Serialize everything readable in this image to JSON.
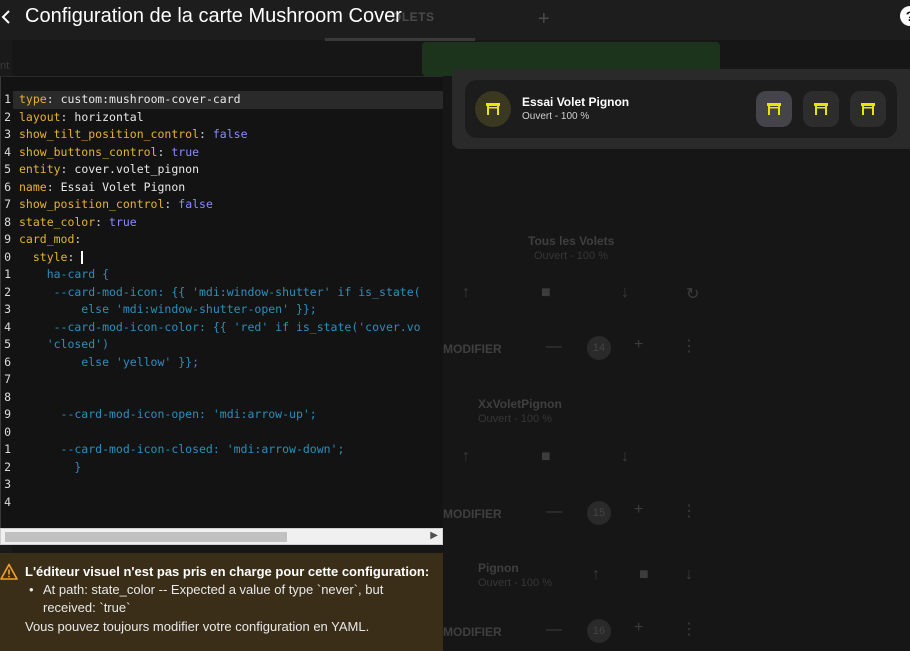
{
  "dialog": {
    "title": "Configuration de la carte Mushroom Cover",
    "back_icon": "arrow-left-icon",
    "help_icon": "help-circle-icon"
  },
  "editor": {
    "line_numbers": [
      "1",
      "2",
      "3",
      "4",
      "5",
      "6",
      "7",
      "8",
      "9",
      "0",
      "1",
      "2",
      "3",
      "4",
      "5",
      "6",
      "7",
      "8",
      "9",
      "0",
      "1",
      "2",
      "3",
      "4"
    ],
    "lines": [
      {
        "key": "type",
        "sep": ": ",
        "value": "custom:mushroom-cover-card",
        "vtype": "v"
      },
      {
        "key": "layout",
        "sep": ": ",
        "value": "horizontal",
        "vtype": "v"
      },
      {
        "key": "show_tilt_position_control",
        "sep": ": ",
        "value": "false",
        "vtype": "b"
      },
      {
        "key": "show_buttons_control",
        "sep": ": ",
        "value": "true",
        "vtype": "b"
      },
      {
        "key": "entity",
        "sep": ": ",
        "value": "cover.volet_pignon",
        "vtype": "v"
      },
      {
        "key": "name",
        "sep": ": ",
        "value": "Essai Volet Pignon",
        "vtype": "v"
      },
      {
        "key": "show_position_control",
        "sep": ": ",
        "value": "false",
        "vtype": "b"
      },
      {
        "key": "state_color",
        "sep": ": ",
        "value": "true",
        "vtype": "b"
      },
      {
        "key": "card_mod",
        "sep": ":",
        "value": "",
        "vtype": "v"
      },
      {
        "key": "  style",
        "sep": ": ",
        "value": "|",
        "vtype": "cursor"
      },
      {
        "key": "",
        "sep": "",
        "value": "    ha-card {",
        "vtype": "t"
      },
      {
        "key": "",
        "sep": "",
        "value": "     --card-mod-icon: {{ 'mdi:window-shutter' if is_state(",
        "vtype": "t"
      },
      {
        "key": "",
        "sep": "",
        "value": "         else 'mdi:window-shutter-open' }};",
        "vtype": "t"
      },
      {
        "key": "",
        "sep": "",
        "value": "     --card-mod-icon-color: {{ 'red' if is_state('cover.vo",
        "vtype": "t"
      },
      {
        "key": "",
        "sep": "",
        "value": "    'closed')",
        "vtype": "t"
      },
      {
        "key": "",
        "sep": "",
        "value": "         else 'yellow' }};",
        "vtype": "t"
      },
      {
        "key": "",
        "sep": "",
        "value": "",
        "vtype": "t"
      },
      {
        "key": "",
        "sep": "",
        "value": "",
        "vtype": "t"
      },
      {
        "key": "",
        "sep": "",
        "value": "      --card-mod-icon-open: 'mdi:arrow-up';",
        "vtype": "t"
      },
      {
        "key": "",
        "sep": "",
        "value": "",
        "vtype": "t"
      },
      {
        "key": "",
        "sep": "",
        "value": "      --card-mod-icon-closed: 'mdi:arrow-down';",
        "vtype": "t"
      },
      {
        "key": "",
        "sep": "",
        "value": "        }",
        "vtype": "t"
      },
      {
        "key": "",
        "sep": "",
        "value": "",
        "vtype": "t"
      },
      {
        "key": "",
        "sep": "",
        "value": "",
        "vtype": "t"
      }
    ]
  },
  "warning": {
    "icon": "alert-triangle-icon",
    "title": "L'éditeur visuel n'est pas pris en charge pour cette configuration:",
    "items": [
      "At path: state_color -- Expected a value of type `never`, but received: `true`"
    ],
    "footer": "Vous pouvez toujours modifier votre configuration en YAML."
  },
  "preview": {
    "name": "Essai Volet Pignon",
    "state": "Ouvert - 100 %",
    "icon": "window-shutter-open-icon",
    "icon_color": "#e6e600",
    "buttons": [
      {
        "icon": "window-shutter-open-icon",
        "active": true
      },
      {
        "icon": "window-shutter-icon",
        "active": false
      },
      {
        "icon": "window-shutter-icon",
        "active": false
      }
    ]
  },
  "background": {
    "tab_label": "OLETS",
    "left_label": "nt",
    "rows": [
      {
        "name": "Tous les Volets",
        "state": "Ouvert - 100 %"
      },
      {
        "label": "MODIFIER",
        "count": "14"
      },
      {
        "name": "XxVoletPignon",
        "state": "Ouvert - 100 %"
      },
      {
        "label": "MODIFIER",
        "count": "15"
      },
      {
        "name": "Pignon",
        "state": "Ouvert - 100 %"
      },
      {
        "label": "MODIFIER",
        "count": "16"
      }
    ]
  }
}
